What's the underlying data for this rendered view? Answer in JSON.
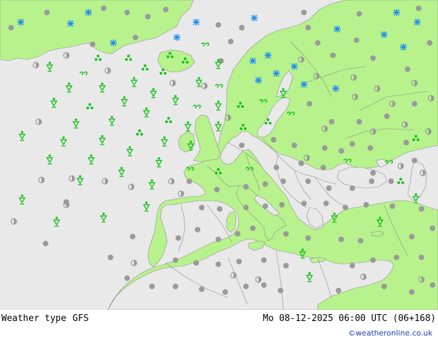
{
  "footer": {
    "title": "Weather type",
    "model": "GFS",
    "datetime": "Mo 08-12-2025 06:00 UTC (06+168)",
    "credit": "©weatheronline.co.uk"
  },
  "colors": {
    "sea": "#e9e9ea",
    "land": "#b8f28d",
    "border": "#8a8a8a",
    "rain": "#1ec01e",
    "snow": "#1e8cf0",
    "cloud": "#9a9a9a"
  },
  "legend_icons": [
    "snow-icon",
    "rain-shower-icon",
    "drizzle-icon",
    "rain-icon",
    "cloudy-icon",
    "partly-cloudy-icon"
  ]
}
